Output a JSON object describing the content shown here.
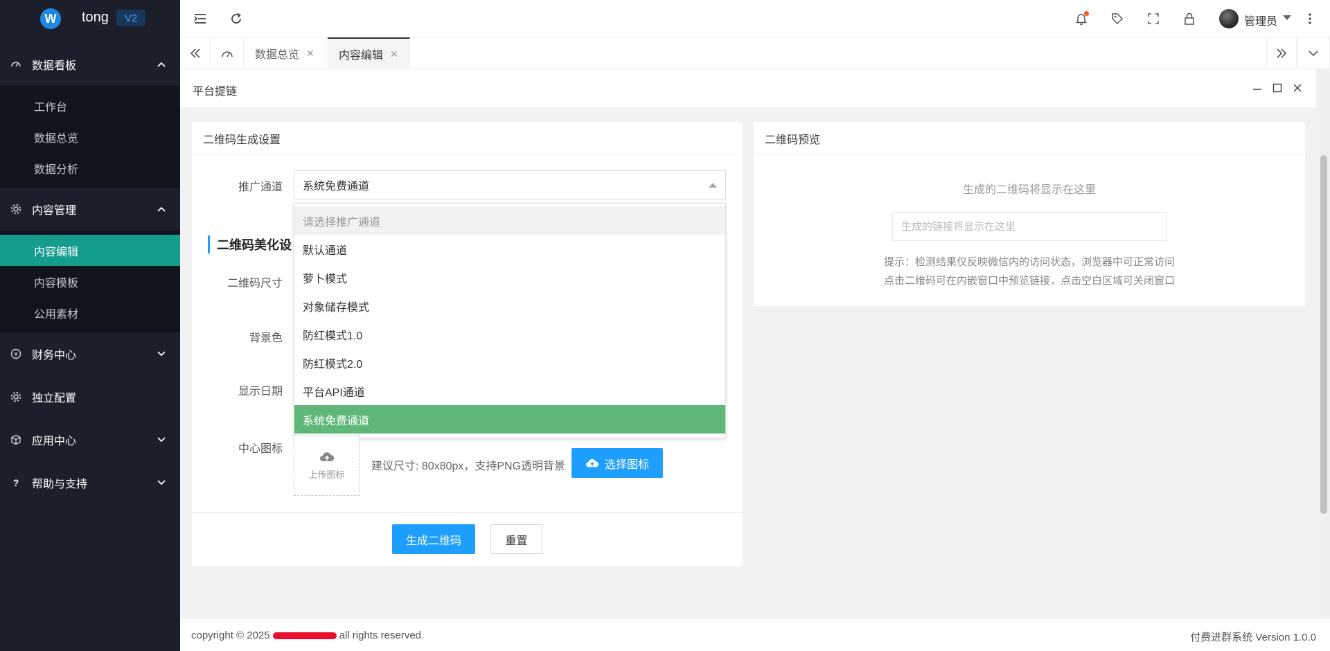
{
  "app": {
    "name": "tong",
    "version_badge": "V2",
    "logo_letter": "W"
  },
  "sidebar": {
    "groups": [
      {
        "label": "数据看板",
        "items": [
          "工作台",
          "数据总览",
          "数据分析"
        ]
      },
      {
        "label": "内容管理",
        "items": [
          "内容编辑",
          "内容模板",
          "公用素材"
        ]
      },
      {
        "label": "财务中心"
      },
      {
        "label": "独立配置"
      },
      {
        "label": "应用中心"
      },
      {
        "label": "帮助与支持"
      }
    ],
    "active_item": "内容编辑"
  },
  "header": {
    "user": "管理员",
    "has_notification": true
  },
  "tabs": [
    {
      "label": "数据总览",
      "active": false
    },
    {
      "label": "内容编辑",
      "active": true
    }
  ],
  "panel": {
    "title": "平台提链"
  },
  "form_card": {
    "title": "二维码生成设置",
    "channel_label": "推广通道",
    "channel_value": "系统免费通道",
    "dropdown_options": [
      "请选择推广通道",
      "默认通道",
      "萝卜模式",
      "对象储存模式",
      "防红模式1.0",
      "防红模式2.0",
      "平台API通道",
      "系统免费通道"
    ],
    "section_title": "二维码美化设",
    "size_label": "二维码尺寸",
    "bg_label": "背景色",
    "date_label": "显示日期",
    "icon_label": "中心图标",
    "upload_text": "上传图标",
    "upload_hint": "建议尺寸: 80x80px，支持PNG透明背景",
    "choose_icon_button": "选择图标",
    "generate_button": "生成二维码",
    "reset_button": "重置"
  },
  "preview_card": {
    "title": "二维码预览",
    "placeholder_text": "生成的二维码将显示在这里",
    "link_placeholder": "生成的链接将显示在这里",
    "tip_line1": "提示：检测结果仅反映微信内的访问状态，浏览器中可正常访问",
    "tip_line2": "点击二维码可在内嵌窗口中预览链接，点击空白区域可关闭窗口"
  },
  "footer": {
    "copyright_prefix": "copyright © 2025",
    "copyright_suffix": "all rights reserved.",
    "system_version": "付费进群系统 Version 1.0.0"
  },
  "colors": {
    "sidebar_bg": "#1c1f2b",
    "active_nav": "#149c8d",
    "primary": "#1e9fff",
    "selected_option": "#5fb878"
  }
}
